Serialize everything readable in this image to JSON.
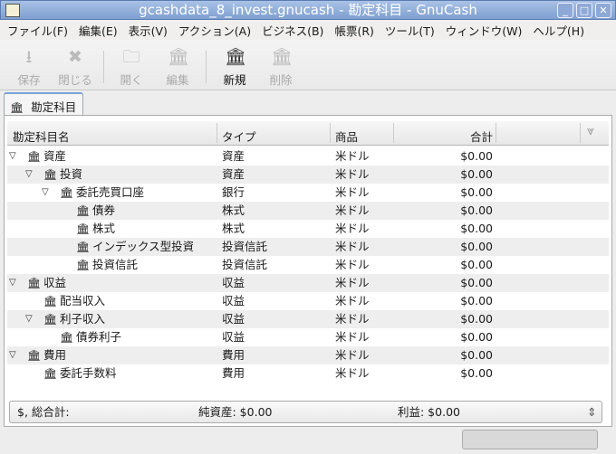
{
  "window": {
    "title": "gcashdata_8_invest.gnucash - 勘定科目 - GnuCash",
    "controls": [
      "minimize",
      "maximize",
      "close"
    ]
  },
  "menu": [
    "ファイル(F)",
    "編集(E)",
    "表示(V)",
    "アクション(A)",
    "ビジネス(B)",
    "帳票(R)",
    "ツール(T)",
    "ウィンドウ(W)",
    "ヘルプ(H)"
  ],
  "toolbar": {
    "save": "保存",
    "close": "閉じる",
    "open": "開く",
    "edit": "編集",
    "new": "新規",
    "delete": "削除"
  },
  "tab": {
    "label": "勘定科目"
  },
  "columns": {
    "name": "勘定科目名",
    "type": "タイプ",
    "commodity": "商品",
    "total": "合計"
  },
  "accounts": [
    {
      "name": "資産",
      "type": "資産",
      "commodity": "米ドル",
      "total": "$0.00",
      "level": 0,
      "expanded": true
    },
    {
      "name": "投資",
      "type": "資産",
      "commodity": "米ドル",
      "total": "$0.00",
      "level": 1,
      "expanded": true
    },
    {
      "name": "委託売買口座",
      "type": "銀行",
      "commodity": "米ドル",
      "total": "$0.00",
      "level": 2,
      "expanded": true
    },
    {
      "name": "債券",
      "type": "株式",
      "commodity": "米ドル",
      "total": "$0.00",
      "level": 3
    },
    {
      "name": "株式",
      "type": "株式",
      "commodity": "米ドル",
      "total": "$0.00",
      "level": 3
    },
    {
      "name": "インデックス型投資",
      "type": "投資信託",
      "commodity": "米ドル",
      "total": "$0.00",
      "level": 3
    },
    {
      "name": "投資信託",
      "type": "投資信託",
      "commodity": "米ドル",
      "total": "$0.00",
      "level": 3
    },
    {
      "name": "収益",
      "type": "収益",
      "commodity": "米ドル",
      "total": "$0.00",
      "level": 0,
      "expanded": true
    },
    {
      "name": "配当収入",
      "type": "収益",
      "commodity": "米ドル",
      "total": "$0.00",
      "level": 1
    },
    {
      "name": "利子収入",
      "type": "収益",
      "commodity": "米ドル",
      "total": "$0.00",
      "level": 1,
      "expanded": true
    },
    {
      "name": "債券利子",
      "type": "収益",
      "commodity": "米ドル",
      "total": "$0.00",
      "level": 2
    },
    {
      "name": "費用",
      "type": "費用",
      "commodity": "米ドル",
      "total": "$0.00",
      "level": 0,
      "expanded": true
    },
    {
      "name": "委託手数料",
      "type": "費用",
      "commodity": "米ドル",
      "total": "$0.00",
      "level": 1
    }
  ],
  "summary": {
    "label": "$, 総合計:",
    "net_assets": "純資産: $0.00",
    "profit": "利益: $0.00"
  }
}
